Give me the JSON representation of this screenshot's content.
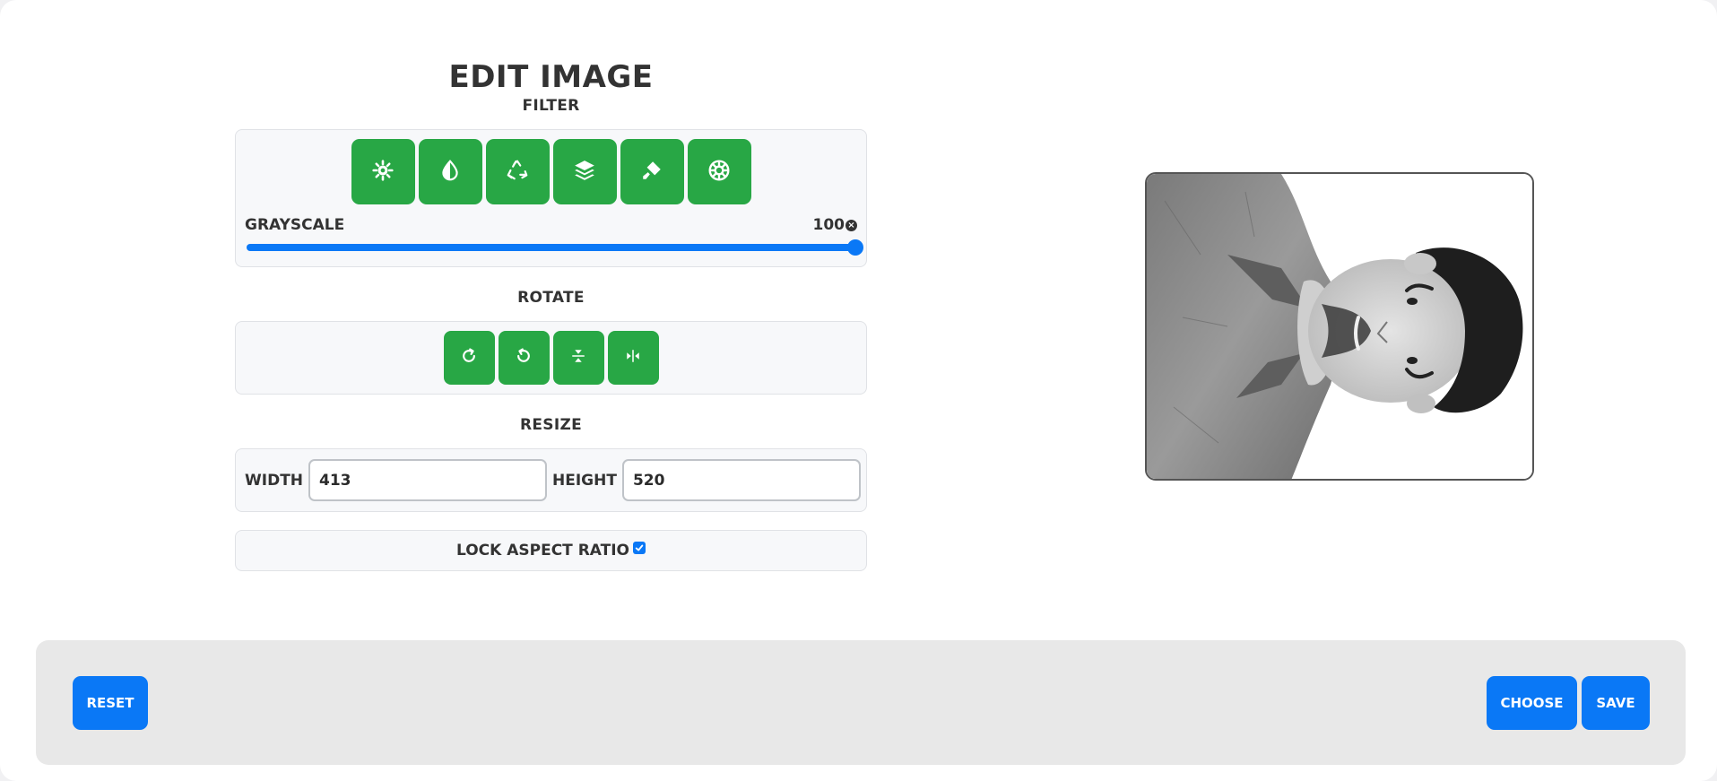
{
  "editor": {
    "title": "Edit Image",
    "filter": {
      "section_label": "Filter",
      "buttons": [
        {
          "icon": "brightness-icon"
        },
        {
          "icon": "contrast-icon"
        },
        {
          "icon": "recycle-icon"
        },
        {
          "icon": "layers-icon"
        },
        {
          "icon": "paint-roller-icon"
        },
        {
          "icon": "aperture-icon"
        }
      ],
      "active_filter_label": "Grayscale",
      "value_text": "100",
      "value": 100,
      "clear_icon": "×"
    },
    "rotate": {
      "section_label": "Rotate",
      "buttons": [
        {
          "icon": "rotate-right-icon"
        },
        {
          "icon": "rotate-left-icon"
        },
        {
          "icon": "flip-vertical-icon"
        },
        {
          "icon": "flip-horizontal-icon"
        }
      ]
    },
    "resize": {
      "section_label": "Resize",
      "width_label": "Width",
      "width_value": "413",
      "height_label": "Height",
      "height_value": "520"
    },
    "lock": {
      "label": "Lock Aspect Ratio",
      "checked": true
    }
  },
  "preview": {
    "alt": "Grayscale rotated portrait preview"
  },
  "footer": {
    "reset_label": "Reset",
    "choose_label": "Choose",
    "save_label": "Save"
  },
  "colors": {
    "green": "#28a745",
    "blue": "#0a78f6",
    "footer_bg": "#e8e8e8"
  }
}
